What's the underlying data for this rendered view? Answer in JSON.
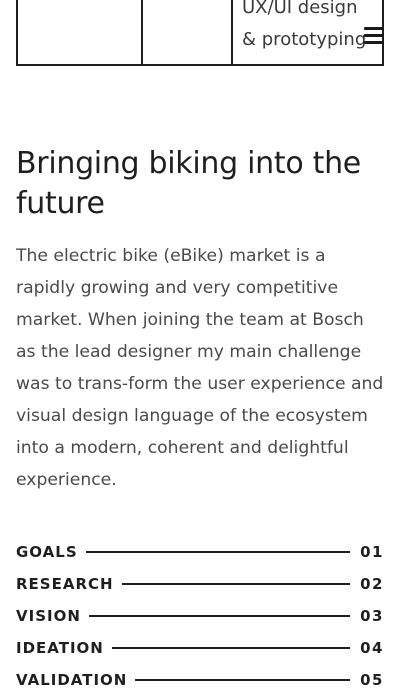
{
  "meta_table": {
    "role_text": "UX/UI design & prototyping"
  },
  "menu": {
    "icon": "hamburger-menu-icon"
  },
  "headline": "Bringing biking into the future",
  "intro": "The electric bike (eBike) market is a rapidly growing and very competitive market. When joining the team at Bosch as the lead designer my main challenge was to trans-form the user experience and visual design language of the ecosystem into a modern, coherent and delightful experience.",
  "toc": [
    {
      "label": "GOALS",
      "number": "01"
    },
    {
      "label": "RESEARCH",
      "number": "02"
    },
    {
      "label": "VISION",
      "number": "03"
    },
    {
      "label": "IDEATION",
      "number": "04"
    },
    {
      "label": "VALIDATION",
      "number": "05"
    }
  ]
}
